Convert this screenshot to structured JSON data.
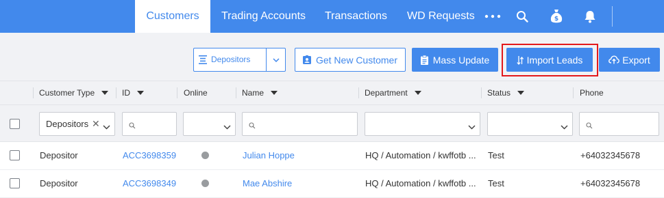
{
  "nav": {
    "tabs": [
      {
        "label": "Customers",
        "active": true
      },
      {
        "label": "Trading Accounts",
        "active": false
      },
      {
        "label": "Transactions",
        "active": false
      },
      {
        "label": "WD Requests",
        "active": false
      }
    ],
    "icons": [
      "more-icon",
      "search-icon",
      "money-bag-icon",
      "bell-icon"
    ]
  },
  "toolbar": {
    "segment_select": {
      "value": "Depositors"
    },
    "buttons": {
      "get_new_customer": "Get New Customer",
      "mass_update": "Mass Update",
      "import_leads": "Import Leads",
      "export": "Export"
    }
  },
  "table": {
    "columns": [
      "Customer Type",
      "ID",
      "Online",
      "Name",
      "Department",
      "Status",
      "Phone"
    ],
    "filters": {
      "customer_type": "Depositors"
    },
    "rows": [
      {
        "customer_type": "Depositor",
        "id": "ACC3698359",
        "online": "offline",
        "name": "Julian Hoppe",
        "department": "HQ / Automation / kwffotb ...",
        "status": "Test",
        "phone": "+64032345678"
      },
      {
        "customer_type": "Depositor",
        "id": "ACC3698349",
        "online": "offline",
        "name": "Mae Abshire",
        "department": "HQ / Automation / kwffotb ...",
        "status": "Test",
        "phone": "+64032345678"
      }
    ]
  },
  "colors": {
    "accent": "#4289ec",
    "highlight": "#e3181b",
    "offline_dot": "#999c9f"
  }
}
